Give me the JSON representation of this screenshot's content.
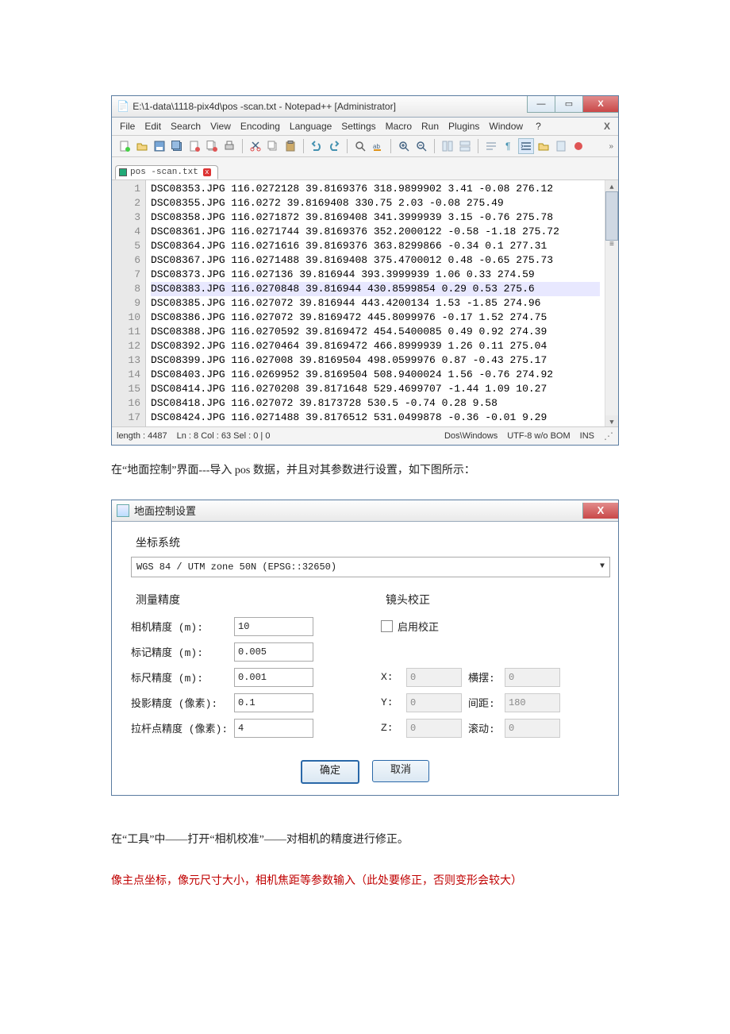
{
  "npp": {
    "title": "E:\\1-data\\1118-pix4d\\pos -scan.txt - Notepad++ [Administrator]",
    "menus": [
      "File",
      "Edit",
      "Search",
      "View",
      "Encoding",
      "Language",
      "Settings",
      "Macro",
      "Run",
      "Plugins",
      "Window"
    ],
    "menu_q": "?",
    "tab_name": "pos -scan.txt",
    "lines": [
      "DSC08353.JPG 116.0272128 39.8169376 318.9899902 3.41 -0.08 276.12",
      "DSC08355.JPG 116.0272 39.8169408 330.75 2.03 -0.08 275.49",
      "DSC08358.JPG 116.0271872 39.8169408 341.3999939 3.15 -0.76 275.78",
      "DSC08361.JPG 116.0271744 39.8169376 352.2000122 -0.58 -1.18 275.72",
      "DSC08364.JPG 116.0271616 39.8169376 363.8299866 -0.34 0.1 277.31",
      "DSC08367.JPG 116.0271488 39.8169408 375.4700012 0.48 -0.65 275.73",
      "DSC08373.JPG 116.027136 39.816944 393.3999939 1.06 0.33 274.59",
      "DSC08383.JPG 116.0270848 39.816944 430.8599854 0.29 0.53 275.6",
      "DSC08385.JPG 116.027072 39.816944 443.4200134 1.53 -1.85 274.96",
      "DSC08386.JPG 116.027072 39.8169472 445.8099976 -0.17 1.52 274.75",
      "DSC08388.JPG 116.0270592 39.8169472 454.5400085 0.49 0.92 274.39",
      "DSC08392.JPG 116.0270464 39.8169472 466.8999939 1.26 0.11 275.04",
      "DSC08399.JPG 116.027008 39.8169504 498.0599976 0.87 -0.43 275.17",
      "DSC08403.JPG 116.0269952 39.8169504 508.9400024 1.56 -0.76 274.92",
      "DSC08414.JPG 116.0270208 39.8171648 529.4699707 -1.44 1.09 10.27",
      "DSC08418.JPG 116.027072 39.8173728 530.5 -0.74 0.28 9.58",
      "DSC08424.JPG 116.0271488 39.8176512 531.0499878 -0.36 -0.01 9.29"
    ],
    "highlight_index": 7,
    "status": {
      "length": "length : 4487",
      "pos": "Ln : 8    Col : 63    Sel : 0 | 0",
      "eol": "Dos\\Windows",
      "enc": "UTF-8 w/o BOM",
      "ins": "INS"
    }
  },
  "para1": "在“地面控制”界面---导入 pos 数据，并且对其参数进行设置，如下图所示：",
  "dlg": {
    "title": "地面控制设置",
    "coord_label": "坐标系统",
    "coord_value": "WGS 84 / UTM zone 50N (EPSG::32650)",
    "left": {
      "title": "测量精度",
      "r1_lbl": "相机精度 (m):",
      "r1_val": "10",
      "r2_lbl": "标记精度 (m):",
      "r2_val": "0.005",
      "r3_lbl": "标尺精度 (m):",
      "r3_val": "0.001",
      "r4_lbl": "投影精度 (像素):",
      "r4_val": "0.1",
      "r5_lbl": "拉杆点精度 (像素):",
      "r5_val": "4"
    },
    "right": {
      "title": "镜头校正",
      "enable": "启用校正",
      "x_lbl": "X:",
      "x_val": "0",
      "heng_lbl": "横摆:",
      "heng_val": "0",
      "y_lbl": "Y:",
      "y_val": "0",
      "jian_lbl": "间距:",
      "jian_val": "180",
      "z_lbl": "Z:",
      "z_val": "0",
      "gun_lbl": "滚动:",
      "gun_val": "0"
    },
    "ok": "确定",
    "cancel": "取消"
  },
  "para2": "在“工具”中――打开“相机校准”――对相机的精度进行修正。",
  "para3": "像主点坐标，像元尺寸大小，相机焦距等参数输入（此处要修正，否则变形会较大）"
}
